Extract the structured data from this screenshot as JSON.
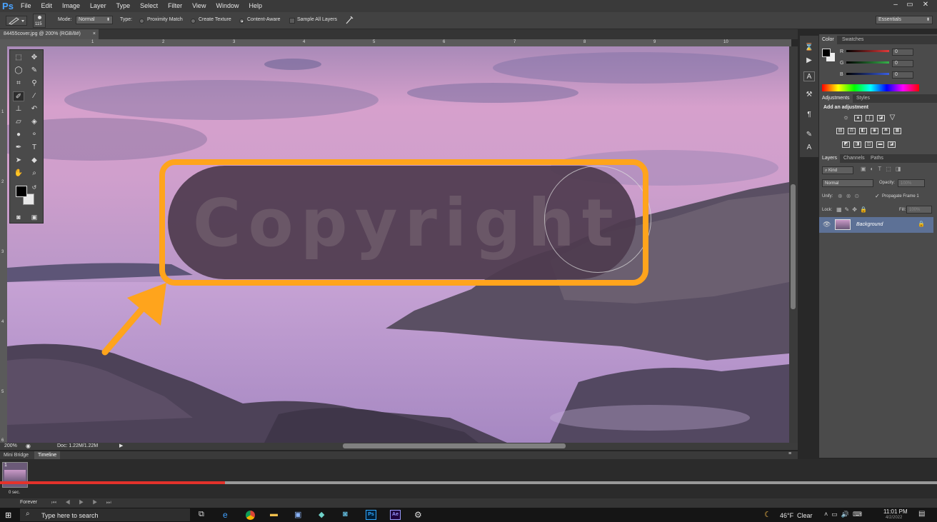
{
  "app": {
    "logo": "Ps",
    "accent": "#ffa41c",
    "progress_red": "#e4322b"
  },
  "menubar": {
    "items": [
      "File",
      "Edit",
      "Image",
      "Layer",
      "Type",
      "Select",
      "Filter",
      "View",
      "Window",
      "Help"
    ],
    "window_controls": [
      "–",
      "▭",
      "✕"
    ]
  },
  "options": {
    "brush_size": "115",
    "mode_label": "Mode:",
    "mode_value": "Normal",
    "type_label": "Type:",
    "type_options": [
      {
        "label": "Proximity Match",
        "selected": false
      },
      {
        "label": "Create Texture",
        "selected": false
      },
      {
        "label": "Content-Aware",
        "selected": true
      }
    ],
    "sample_all_layers": "Sample All Layers",
    "workspace": "Essentials"
  },
  "document": {
    "tab_title": "84455cover.jpg @ 200% (RGB/8#)",
    "close": "×"
  },
  "rulers": {
    "h": [
      "1",
      "2",
      "3",
      "4",
      "5",
      "6",
      "7",
      "8",
      "9",
      "10"
    ],
    "v": [
      "1",
      "2",
      "3",
      "4",
      "5",
      "6"
    ]
  },
  "canvas": {
    "watermark_text": "Copyright"
  },
  "status": {
    "zoom": "200%",
    "doc_info": "Doc: 1.22M/1.22M"
  },
  "timeline": {
    "tabs": [
      "Mini Bridge",
      "Timeline"
    ],
    "frame_number": "1",
    "frame_delay": "0 sec.",
    "loop": "Forever",
    "progress_fraction": 0.24
  },
  "color_panel": {
    "tabs": [
      "Color",
      "Swatches"
    ],
    "channels": [
      {
        "label": "R",
        "value": "0",
        "color": "#e23a3a"
      },
      {
        "label": "G",
        "value": "0",
        "color": "#36b14a"
      },
      {
        "label": "B",
        "value": "0",
        "color": "#3a5ee2"
      }
    ]
  },
  "adjustments_panel": {
    "tabs": [
      "Adjustments",
      "Styles"
    ],
    "heading": "Add an adjustment"
  },
  "layers_panel": {
    "tabs": [
      "Layers",
      "Channels",
      "Paths"
    ],
    "filter_kind": "Kind",
    "blend_mode": "Normal",
    "opacity_label": "Opacity:",
    "opacity_value": "100%",
    "unify_label": "Unify:",
    "propagate_label": "Propagate Frame 1",
    "lock_label": "Lock:",
    "fill_label": "Fill:",
    "fill_value": "100%",
    "layers": [
      {
        "name": "Background",
        "locked": true,
        "visible": true
      }
    ]
  },
  "taskbar": {
    "search_placeholder": "Type here to search",
    "weather_temp": "46°F",
    "weather_desc": "Clear",
    "time": "11:01 PM",
    "date": "4/2/2022"
  }
}
